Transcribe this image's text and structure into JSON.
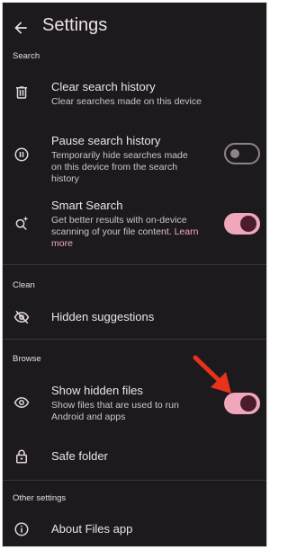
{
  "header": {
    "title": "Settings"
  },
  "sections": {
    "search": "Search",
    "clean": "Clean",
    "browse": "Browse",
    "other": "Other settings"
  },
  "items": {
    "clear_history": {
      "title": "Clear search history",
      "subtitle": "Clear searches made on this device"
    },
    "pause_history": {
      "title": "Pause search history",
      "subtitle": "Temporarily hide searches made on this device from the search history",
      "toggle": "off"
    },
    "smart_search": {
      "title": "Smart Search",
      "subtitle": "Get better results with on-device scanning of your file content.",
      "link": "Learn more",
      "toggle": "on"
    },
    "hidden_suggestions": {
      "title": "Hidden suggestions"
    },
    "show_hidden_files": {
      "title": "Show hidden files",
      "subtitle": "Show files that are used to run Android and apps",
      "toggle": "on"
    },
    "safe_folder": {
      "title": "Safe folder"
    },
    "about": {
      "title": "About Files app"
    }
  },
  "colors": {
    "background": "#1d1a1e",
    "toggle_on_track": "#f0a7bc",
    "toggle_on_knob": "#4b1d2c",
    "annotation_arrow": "#e8321b"
  },
  "icons": [
    "back-arrow-icon",
    "trash-icon",
    "pause-icon",
    "smart-search-icon",
    "eye-off-icon",
    "eye-icon",
    "lock-icon",
    "info-icon",
    "red-arrow-annotation"
  ]
}
